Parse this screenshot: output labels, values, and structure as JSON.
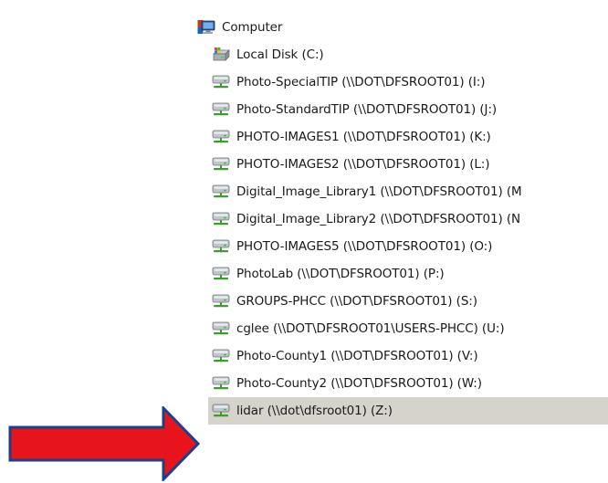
{
  "tree": {
    "root": {
      "label": "Computer",
      "icon": "computer-icon"
    },
    "items": [
      {
        "label": "Local Disk (C:)",
        "icon": "local-disk-icon"
      },
      {
        "label": "Photo-SpecialTIP (\\\\DOT\\DFSROOT01) (I:)",
        "icon": "network-drive-icon"
      },
      {
        "label": "Photo-StandardTIP (\\\\DOT\\DFSROOT01) (J:)",
        "icon": "network-drive-icon"
      },
      {
        "label": "PHOTO-IMAGES1 (\\\\DOT\\DFSROOT01) (K:)",
        "icon": "network-drive-icon"
      },
      {
        "label": "PHOTO-IMAGES2 (\\\\DOT\\DFSROOT01) (L:)",
        "icon": "network-drive-icon"
      },
      {
        "label": "Digital_Image_Library1 (\\\\DOT\\DFSROOT01) (M",
        "icon": "network-drive-icon"
      },
      {
        "label": "Digital_Image_Library2 (\\\\DOT\\DFSROOT01) (N",
        "icon": "network-drive-icon"
      },
      {
        "label": "PHOTO-IMAGES5 (\\\\DOT\\DFSROOT01) (O:)",
        "icon": "network-drive-icon"
      },
      {
        "label": "PhotoLab (\\\\DOT\\DFSROOT01) (P:)",
        "icon": "network-drive-icon"
      },
      {
        "label": "GROUPS-PHCC (\\\\DOT\\DFSROOT01) (S:)",
        "icon": "network-drive-icon"
      },
      {
        "label": "cglee (\\\\DOT\\DFSROOT01\\USERS-PHCC) (U:)",
        "icon": "network-drive-icon"
      },
      {
        "label": "Photo-County1 (\\\\DOT\\DFSROOT01) (V:)",
        "icon": "network-drive-icon"
      },
      {
        "label": "Photo-County2 (\\\\DOT\\DFSROOT01) (W:)",
        "icon": "network-drive-icon"
      },
      {
        "label": "lidar (\\\\dot\\dfsroot01) (Z:)",
        "icon": "network-drive-icon",
        "selected": true
      }
    ]
  },
  "colors": {
    "selection": "#d6d3cd",
    "arrow_fill": "#e8141b",
    "arrow_stroke": "#1d3f8a",
    "drive_green": "#3f9b2f",
    "drive_gray": "#8a9196"
  }
}
